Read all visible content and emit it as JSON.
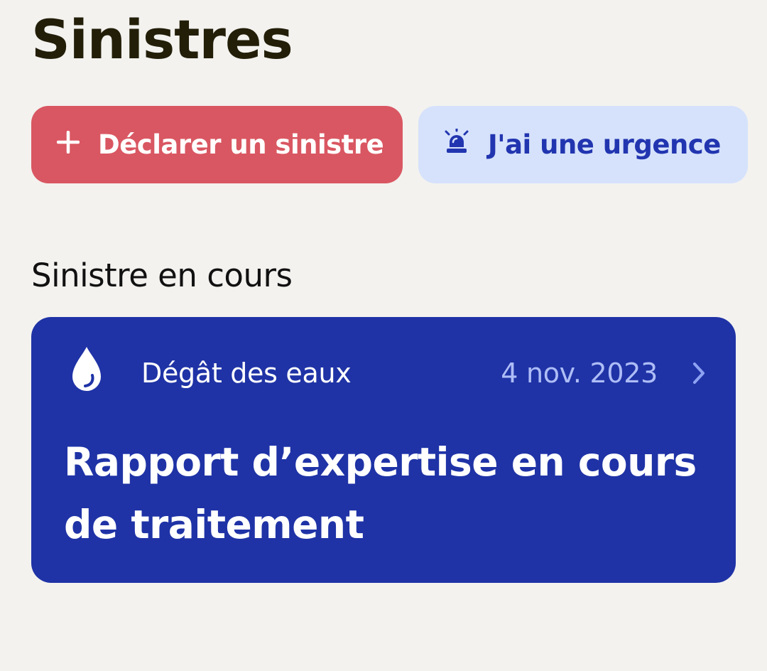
{
  "page": {
    "title": "Sinistres"
  },
  "actions": {
    "declare": {
      "label": "Déclarer un sinistre",
      "icon": "plus-icon",
      "background": "#d95762",
      "text_color": "#ffffff"
    },
    "emergency": {
      "label": "J'ai une urgence",
      "icon": "siren-icon",
      "background": "#d6e2fb",
      "text_color": "#2235b0"
    }
  },
  "current_claims": {
    "section_title": "Sinistre en cours",
    "items": [
      {
        "icon": "water-drop-icon",
        "type": "Dégât des eaux",
        "date": "4 nov. 2023",
        "status": "Rapport d’expertise en cours de traitement",
        "background": "#1f33a6",
        "date_color": "#aebdf6"
      }
    ]
  }
}
